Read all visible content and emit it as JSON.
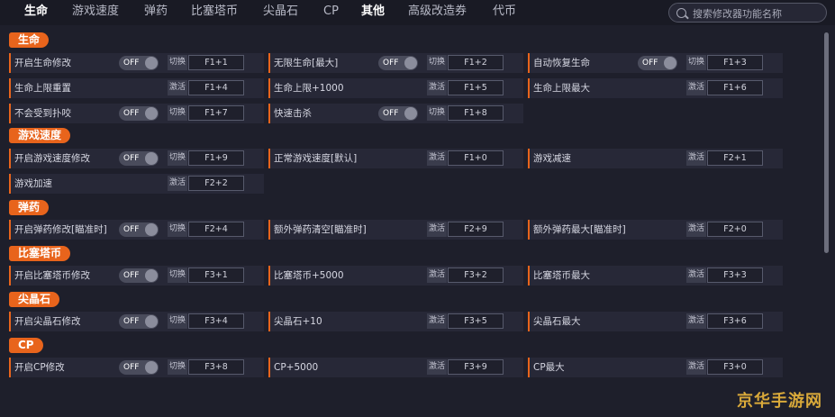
{
  "nav": {
    "tabs": [
      {
        "label": "生命"
      },
      {
        "label": "游戏速度"
      },
      {
        "label": "弹药"
      },
      {
        "label": "比塞塔币"
      },
      {
        "label": "尖晶石"
      },
      {
        "label": "CP"
      },
      {
        "label": "其他"
      },
      {
        "label": "高级改造券"
      },
      {
        "label": "代币"
      }
    ],
    "search_placeholder": "搜索修改器功能名称"
  },
  "toggle_off": "OFF",
  "sections": [
    {
      "title": "生命",
      "rows": [
        [
          {
            "label": "开启生命修改",
            "type": "切换",
            "key": "F1+1"
          },
          {
            "label": "无限生命[最大]",
            "type": "切换",
            "key": "F1+2"
          },
          {
            "label": "自动恢复生命",
            "type": "切换",
            "key": "F1+3"
          }
        ],
        [
          {
            "label": "生命上限重置",
            "type": "激活",
            "key": "F1+4"
          },
          {
            "label": "生命上限+1000",
            "type": "激活",
            "key": "F1+5"
          },
          {
            "label": "生命上限最大",
            "type": "激活",
            "key": "F1+6"
          }
        ],
        [
          {
            "label": "不会受到扑咬",
            "type": "切换",
            "key": "F1+7"
          },
          {
            "label": "快速击杀",
            "type": "切换",
            "key": "F1+8"
          }
        ]
      ]
    },
    {
      "title": "游戏速度",
      "rows": [
        [
          {
            "label": "开启游戏速度修改",
            "type": "切换",
            "key": "F1+9"
          },
          {
            "label": "正常游戏速度[默认]",
            "type": "激活",
            "key": "F1+0"
          },
          {
            "label": "游戏减速",
            "type": "激活",
            "key": "F2+1"
          }
        ],
        [
          {
            "label": "游戏加速",
            "type": "激活",
            "key": "F2+2"
          }
        ]
      ]
    },
    {
      "title": "弹药",
      "rows": [
        [
          {
            "label": "开启弹药修改[瞄准时]",
            "type": "切换",
            "key": "F2+4"
          },
          {
            "label": "额外弹药清空[瞄准时]",
            "type": "激活",
            "key": "F2+9"
          },
          {
            "label": "额外弹药最大[瞄准时]",
            "type": "激活",
            "key": "F2+0"
          }
        ]
      ]
    },
    {
      "title": "比塞塔币",
      "rows": [
        [
          {
            "label": "开启比塞塔币修改",
            "type": "切换",
            "key": "F3+1"
          },
          {
            "label": "比塞塔币+5000",
            "type": "激活",
            "key": "F3+2"
          },
          {
            "label": "比塞塔币最大",
            "type": "激活",
            "key": "F3+3"
          }
        ]
      ]
    },
    {
      "title": "尖晶石",
      "rows": [
        [
          {
            "label": "开启尖晶石修改",
            "type": "切换",
            "key": "F3+4"
          },
          {
            "label": "尖晶石+10",
            "type": "激活",
            "key": "F3+5"
          },
          {
            "label": "尖晶石最大",
            "type": "激活",
            "key": "F3+6"
          }
        ]
      ]
    },
    {
      "title": "CP",
      "rows": [
        [
          {
            "label": "开启CP修改",
            "type": "切换",
            "key": "F3+8"
          },
          {
            "label": "CP+5000",
            "type": "激活",
            "key": "F3+9"
          },
          {
            "label": "CP最大",
            "type": "激活",
            "key": "F3+0"
          }
        ]
      ]
    }
  ],
  "watermark": "京华手游网",
  "colors": {
    "accent": "#e8641c",
    "background": "#1e1f2b",
    "row": "#272837"
  }
}
